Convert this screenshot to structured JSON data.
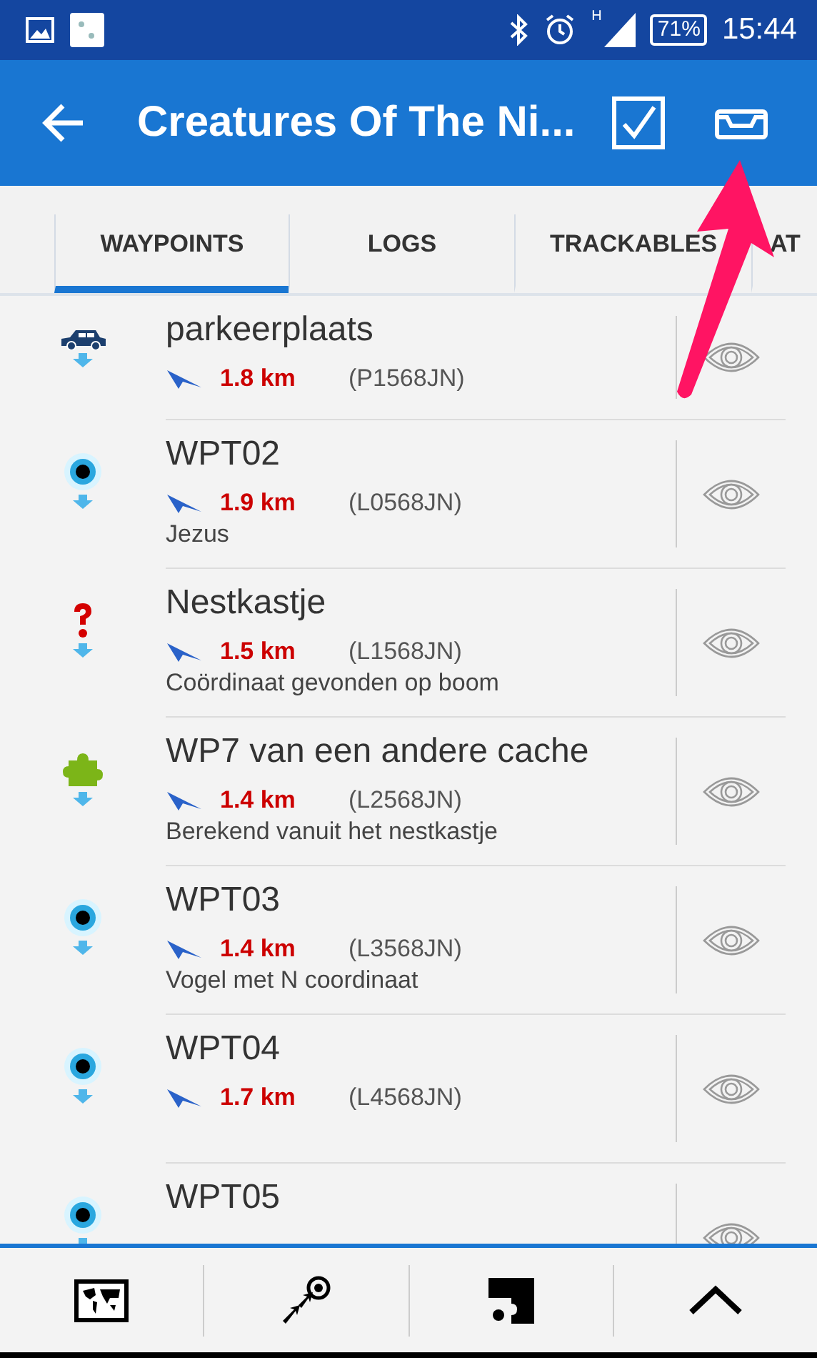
{
  "status_bar": {
    "battery": "71%",
    "time": "15:44",
    "network": "H"
  },
  "app_bar": {
    "title": "Creatures Of The Ni..."
  },
  "tabs": [
    {
      "label": "WAYPOINTS",
      "selected": true
    },
    {
      "label": "LOGS",
      "selected": false
    },
    {
      "label": "TRACKABLES",
      "selected": false
    },
    {
      "label": "AT",
      "selected": false
    }
  ],
  "waypoints": [
    {
      "kind": "parking",
      "name": "parkeerplaats",
      "distance": "1.8 km",
      "code": "(P1568JN)"
    },
    {
      "kind": "reference",
      "name": "WPT02",
      "distance": "1.9 km",
      "code": "(L0568JN)",
      "note": "Jezus"
    },
    {
      "kind": "question",
      "name": "Nestkastje",
      "distance": "1.5 km",
      "code": "(L1568JN)",
      "note": "Coördinaat gevonden op boom"
    },
    {
      "kind": "puzzle",
      "name": "WP7 van een andere cache",
      "distance": "1.4 km",
      "code": "(L2568JN)",
      "note": "Berekend vanuit het nestkastje"
    },
    {
      "kind": "reference",
      "name": "WPT03",
      "distance": "1.4 km",
      "code": "(L3568JN)",
      "note": "Vogel met N coordinaat"
    },
    {
      "kind": "reference",
      "name": "WPT04",
      "distance": "1.7 km",
      "code": "(L4568JN)"
    },
    {
      "kind": "reference",
      "name": "WPT05"
    }
  ]
}
